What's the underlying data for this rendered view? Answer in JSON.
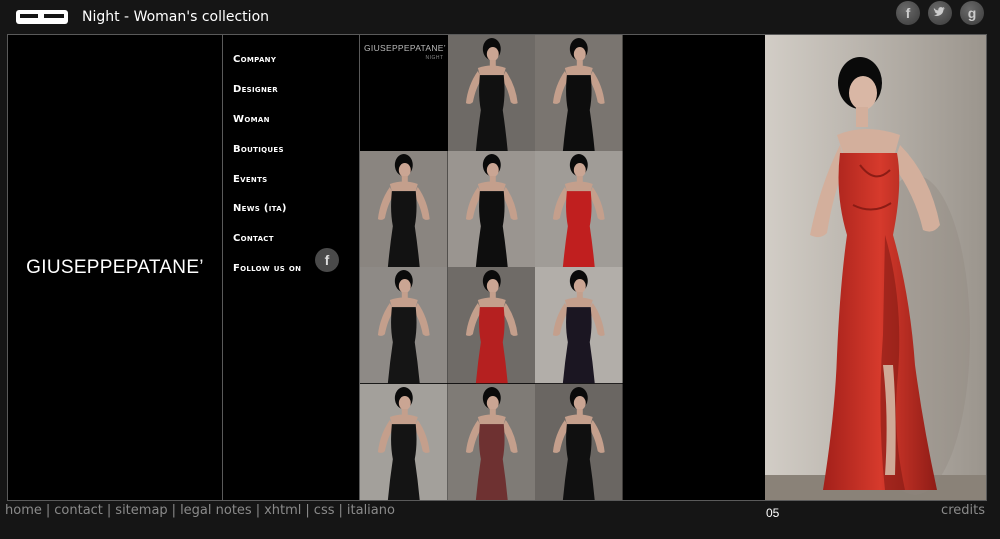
{
  "header": {
    "title": "Night - Woman's collection",
    "social": [
      {
        "icon": "facebook-icon",
        "glyph": "f"
      },
      {
        "icon": "twitter-icon",
        "glyph": "t"
      },
      {
        "icon": "google-icon",
        "glyph": "g"
      }
    ]
  },
  "brand": {
    "name": "GIUSEPPEPATANE’"
  },
  "nav": {
    "items": [
      {
        "label": "Company"
      },
      {
        "label": "Designer"
      },
      {
        "label": "Woman"
      },
      {
        "label": "Boutiques"
      },
      {
        "label": "Events"
      },
      {
        "label": "News (ita)"
      },
      {
        "label": "Contact"
      },
      {
        "label": "Follow us on"
      }
    ],
    "follow_icon": "facebook-icon"
  },
  "grid": {
    "label_brand": "GIUSEPPEPATANE’",
    "label_sub": "NIGHT",
    "thumbs": [
      {
        "dress": "#111111",
        "bg": "#6e6a66"
      },
      {
        "dress": "#0d0d0d",
        "bg": "#7a7570"
      },
      {
        "dress": "#121212",
        "bg": "#8a8580"
      },
      {
        "dress": "#0e0e0e",
        "bg": "#9a9590"
      },
      {
        "dress": "#c01f1f",
        "bg": "#a09c97"
      },
      {
        "dress": "#151515",
        "bg": "#8e8a86"
      },
      {
        "dress": "#b52020",
        "bg": "#6f6b67"
      },
      {
        "dress": "#1b1622",
        "bg": "#b2aea9"
      },
      {
        "dress": "#141414",
        "bg": "#a3a09b"
      },
      {
        "dress": "#6e3131",
        "bg": "#7f7b76"
      },
      {
        "dress": "#101010",
        "bg": "#6a6662"
      }
    ]
  },
  "large_photo": {
    "dress": "#c42a1f",
    "bg": "#b9b4ad"
  },
  "footer": {
    "links": [
      "home",
      "contact",
      "sitemap",
      "legal notes",
      "xhtml",
      "css",
      "italiano"
    ],
    "page_number": "05",
    "credits": "credits"
  },
  "colors": {
    "background": "#151515",
    "panel": "#000000",
    "border": "#5a5a5a",
    "footer_text": "#8a8a8a"
  }
}
